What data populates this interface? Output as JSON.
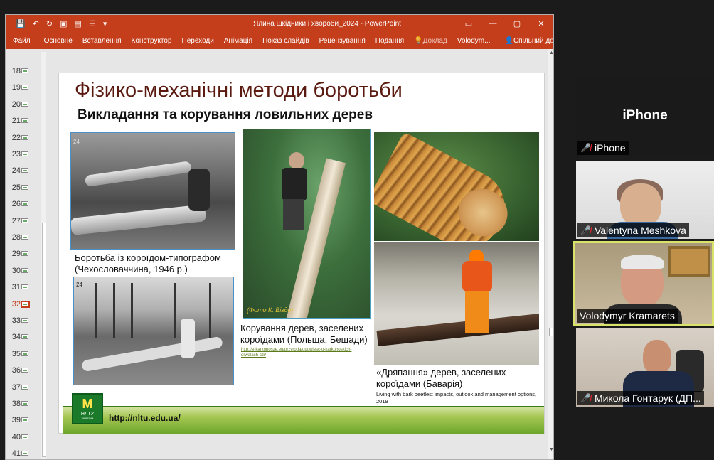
{
  "window": {
    "title": "Ялина шкідники і хвороби_2024 - PowerPoint",
    "quick_access": [
      "💾",
      "↶",
      "↻",
      "▣",
      "▤",
      "☰",
      "▾"
    ],
    "controls": [
      "▭",
      "—",
      "▢",
      "✕"
    ]
  },
  "ribbon": {
    "tabs": [
      "Файл",
      "Основне",
      "Вставлення",
      "Конструктор",
      "Переходи",
      "Анімація",
      "Показ слайдів",
      "Рецензування",
      "Подання"
    ],
    "tell_me": "Доклад",
    "user": "Volodym...",
    "share": "Спільний доступ"
  },
  "thumbnails": {
    "numbers": [
      "18",
      "19",
      "20",
      "21",
      "22",
      "23",
      "24",
      "25",
      "26",
      "27",
      "28",
      "29",
      "30",
      "31",
      "32",
      "33",
      "34",
      "35",
      "36",
      "37",
      "38",
      "39",
      "40",
      "41"
    ],
    "active": "32"
  },
  "slide": {
    "title": "Фізико-механічні методи боротьби",
    "subtitle": "Викладання та корування ловильних дерев",
    "photo1_tag": "24",
    "photo2_tag": "24",
    "caption1_line1": "Боротьба із короїдом-типографом",
    "caption1_line2": "(Чехословаччина, 1946 р.)",
    "photo3_credit": "(Фото К. Віздо)",
    "caption2_line1": "Корування дерев, заселених",
    "caption2_line2": "короїдами (Польща, Бещади)",
    "link_line1": "http://e-karkonosze.eu/przyroda/opowiesc-o-karkonoskich-",
    "link_line2": "drwalach-czi/",
    "caption3_line1": "«Дряпання» дерев, заселених",
    "caption3_line2": "короїдами (Баварія)",
    "reference": "Living with bark beetles: impacts, outlook and management options, 2019",
    "logo_mark": "M",
    "logo_text": "НЛТУ",
    "logo_sub": "УКРАЇНИ",
    "url": "http://nltu.edu.ua/"
  },
  "participants": [
    {
      "name": "iPhone",
      "label": "iPhone",
      "muted": true
    },
    {
      "name": "Valentyna Meshkova",
      "muted": true
    },
    {
      "name": "Volodymyr Kramarets",
      "muted": false,
      "speaking": true
    },
    {
      "name": "Микола Гонтарук (ДП...",
      "muted": true
    }
  ],
  "colors": {
    "ppt_accent": "#c43e1c",
    "title_color": "#5a1a10",
    "speaker_highlight": "#d9e36a",
    "mute_icon": "#e0242a"
  }
}
